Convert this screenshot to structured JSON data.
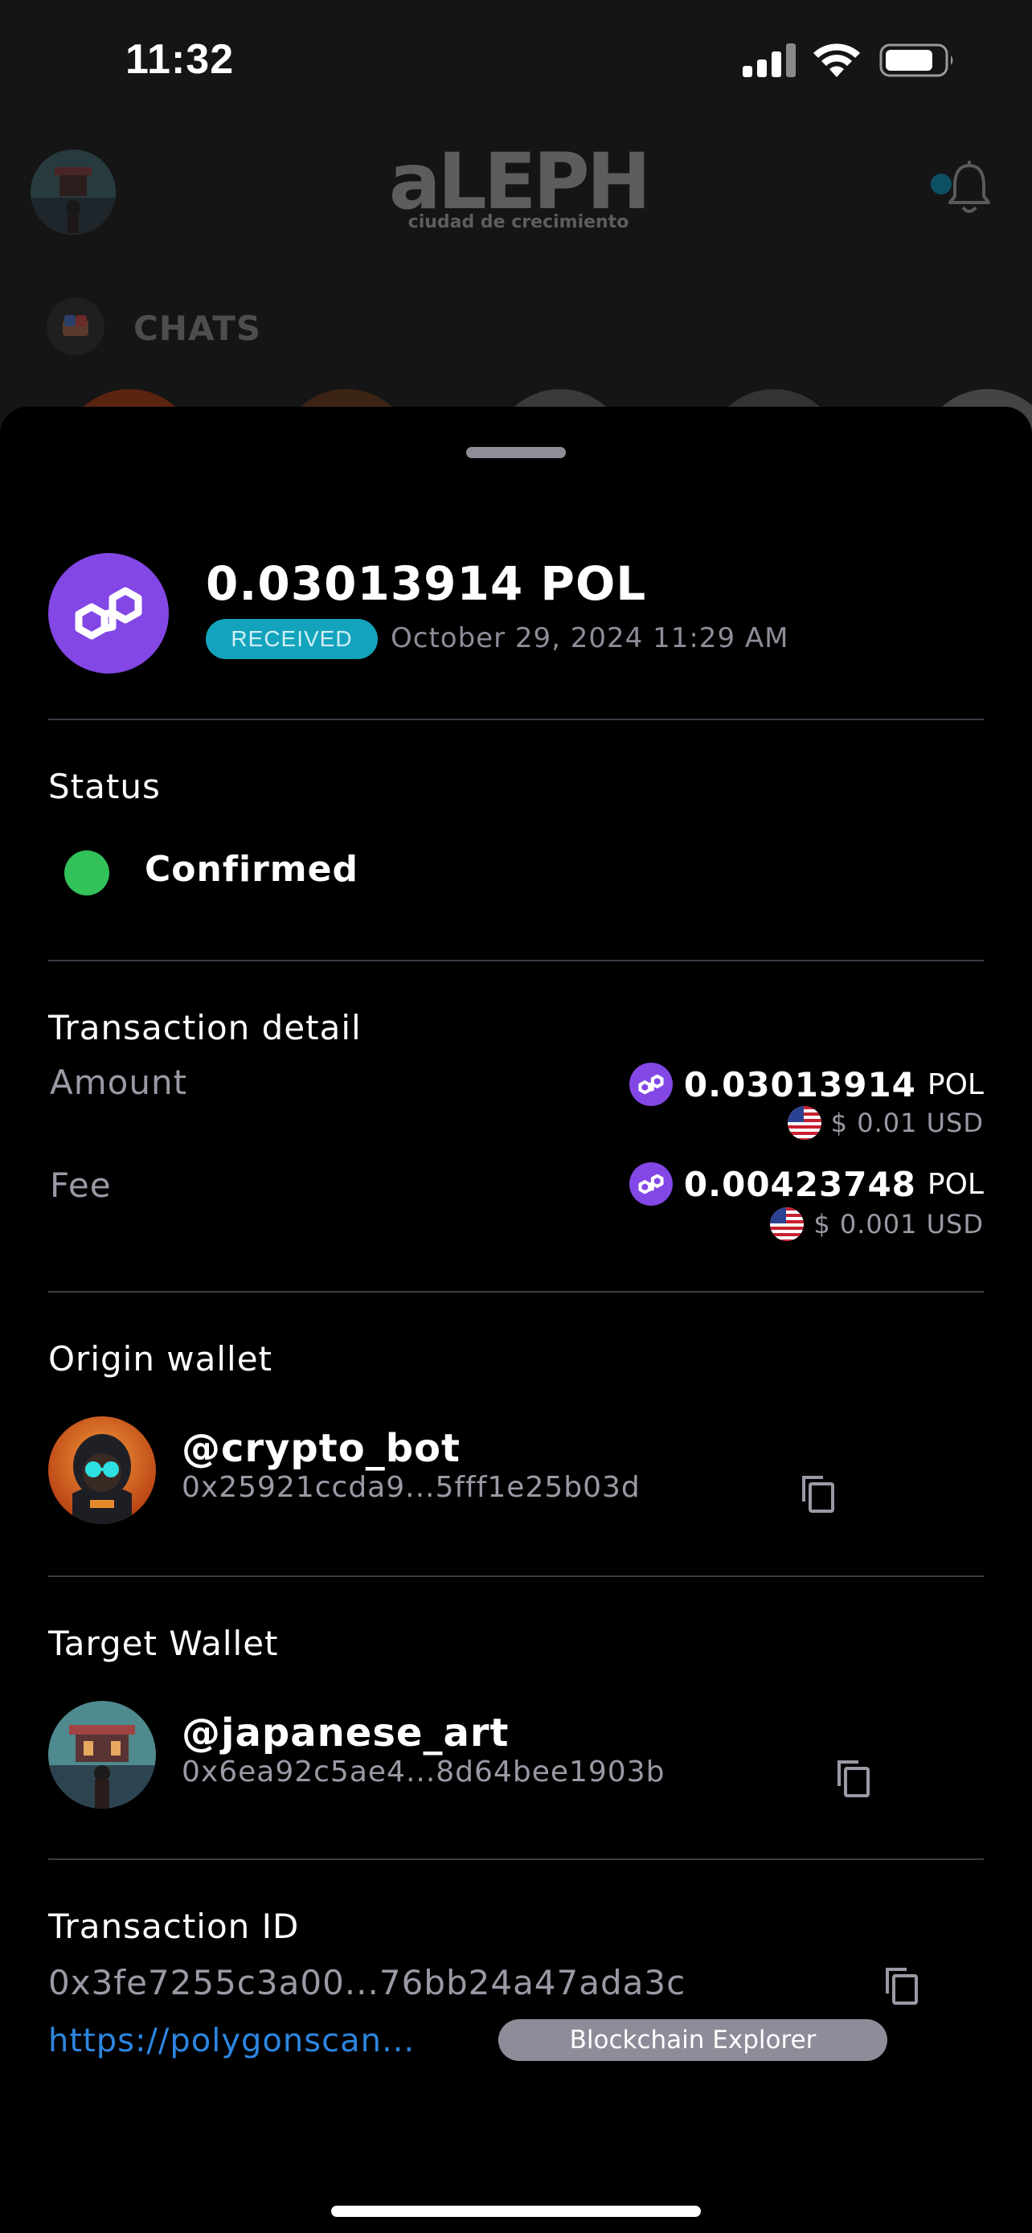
{
  "status_bar": {
    "time": "11:32",
    "icons": [
      "signal-icon",
      "wifi-icon",
      "battery-icon"
    ]
  },
  "background_app": {
    "logo": "aLEPH",
    "logo_subtitle": "ciudad de crecimiento",
    "section_label": "CHATS",
    "icons": [
      "bell-icon",
      "chats-icon"
    ]
  },
  "transaction": {
    "amount_title": "0.03013914 POL",
    "badge": "RECEIVED",
    "date": "October 29, 2024 11:29 AM",
    "status_label": "Status",
    "status_value": "Confirmed",
    "status_color": "#33c15a",
    "detail_label": "Transaction detail",
    "amount_label": "Amount",
    "amount_value": "0.03013914",
    "amount_symbol": "POL",
    "amount_usd": "$ 0.01 USD",
    "fee_label": "Fee",
    "fee_value": "0.00423748",
    "fee_symbol": "POL",
    "fee_usd": "$ 0.001 USD"
  },
  "origin_wallet": {
    "label": "Origin wallet",
    "handle": "@crypto_bot",
    "address": "0x25921ccda9...5fff1e25b03d"
  },
  "target_wallet": {
    "label": "Target Wallet",
    "handle": "@japanese_art",
    "address": "0x6ea92c5ae4...8d64bee1903b"
  },
  "transaction_id": {
    "label": "Transaction ID",
    "value": "0x3fe7255c3a00...76bb24a47ada3c",
    "link": "https://polygonscan...",
    "explorer_button": "Blockchain Explorer"
  },
  "colors": {
    "polygon_purple": "#8247e5",
    "badge_teal": "#14a3bd",
    "link_blue": "#2d86e0"
  }
}
